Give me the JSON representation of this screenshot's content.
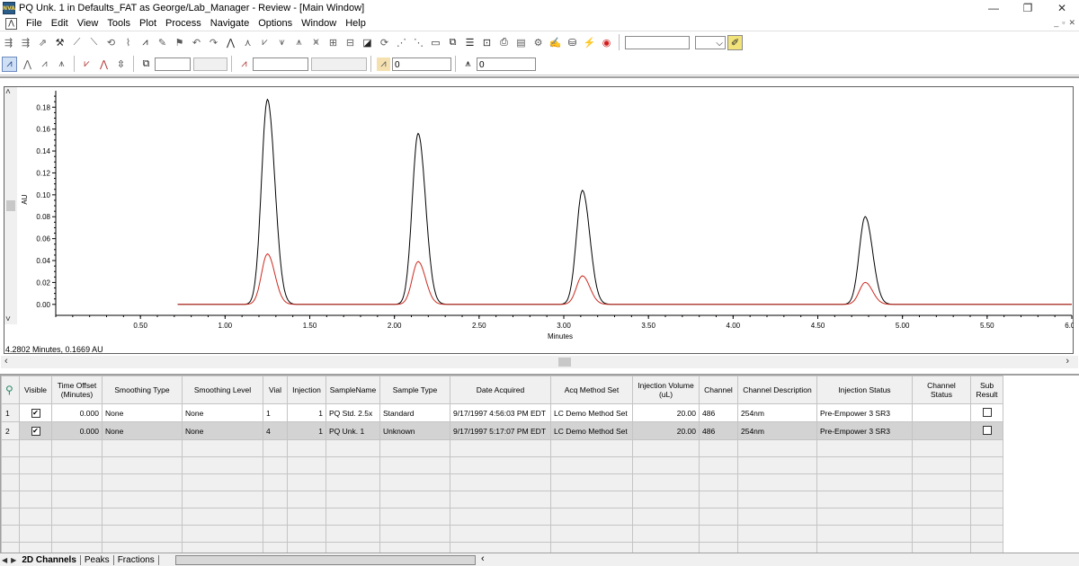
{
  "window": {
    "title": "PQ Unk. 1 in Defaults_FAT as George/Lab_Manager - Review - [Main Window]",
    "app_icon_text": "NVA",
    "minimize": "—",
    "maximize": "❐",
    "close": "✕"
  },
  "menu": {
    "items": [
      "File",
      "Edit",
      "View",
      "Tools",
      "Plot",
      "Process",
      "Navigate",
      "Options",
      "Window",
      "Help"
    ]
  },
  "toolbar2": {
    "field_a": "",
    "field_b": "",
    "field_c": "0",
    "field_d": "0"
  },
  "chart": {
    "cursor_readout": "4.2802 Minutes, 0.1669 AU"
  },
  "chart_data": {
    "type": "line",
    "xlabel": "Minutes",
    "ylabel": "AU",
    "xlim": [
      0.0,
      6.0
    ],
    "ylim": [
      -0.01,
      0.195
    ],
    "x_ticks": [
      "0.50",
      "1.00",
      "1.50",
      "2.00",
      "2.50",
      "3.00",
      "3.50",
      "4.00",
      "4.50",
      "5.00",
      "5.50",
      "6.00"
    ],
    "y_ticks": [
      "0.00",
      "0.02",
      "0.04",
      "0.06",
      "0.08",
      "0.10",
      "0.12",
      "0.14",
      "0.16",
      "0.18"
    ],
    "grid": false,
    "series": [
      {
        "color": "#000000",
        "peaks": [
          {
            "rt": 1.25,
            "height": 0.187
          },
          {
            "rt": 2.14,
            "height": 0.156
          },
          {
            "rt": 3.11,
            "height": 0.104
          },
          {
            "rt": 4.78,
            "height": 0.08
          }
        ]
      },
      {
        "color": "#cc2a1f",
        "peaks": [
          {
            "rt": 1.25,
            "height": 0.046
          },
          {
            "rt": 2.14,
            "height": 0.039
          },
          {
            "rt": 3.11,
            "height": 0.026
          },
          {
            "rt": 4.78,
            "height": 0.02
          }
        ]
      }
    ]
  },
  "table": {
    "headers": [
      "Visible",
      "Time Offset (Minutes)",
      "Smoothing Type",
      "Smoothing Level",
      "Vial",
      "Injection",
      "SampleName",
      "Sample Type",
      "Date Acquired",
      "Acq Method Set",
      "Injection Volume (uL)",
      "Channel",
      "Channel Description",
      "Injection Status",
      "Channel Status",
      "Sub Result"
    ],
    "rows": [
      {
        "num": "1",
        "visible": "✔",
        "time_offset": "0.000",
        "smoothing_type": "None",
        "smoothing_level": "None",
        "vial": "1",
        "injection": "1",
        "sample_name": "PQ Std. 2.5x",
        "sample_type": "Standard",
        "date_acquired": "9/17/1997 4:56:03 PM EDT",
        "acq_method_set": "LC Demo Method Set",
        "injection_volume": "20.00",
        "channel": "486",
        "channel_description": "254nm",
        "injection_status": "Pre-Empower 3 SR3",
        "channel_status": "",
        "sub_result": ""
      },
      {
        "num": "2",
        "visible": "✔",
        "time_offset": "0.000",
        "smoothing_type": "None",
        "smoothing_level": "None",
        "vial": "4",
        "injection": "1",
        "sample_name": "PQ Unk. 1",
        "sample_type": "Unknown",
        "date_acquired": "9/17/1997 5:17:07 PM EDT",
        "acq_method_set": "LC Demo Method Set",
        "injection_volume": "20.00",
        "channel": "486",
        "channel_description": "254nm",
        "injection_status": "Pre-Empower 3 SR3",
        "channel_status": "",
        "sub_result": ""
      }
    ]
  },
  "tabs": [
    "2D Channels",
    "Peaks",
    "Fractions"
  ]
}
